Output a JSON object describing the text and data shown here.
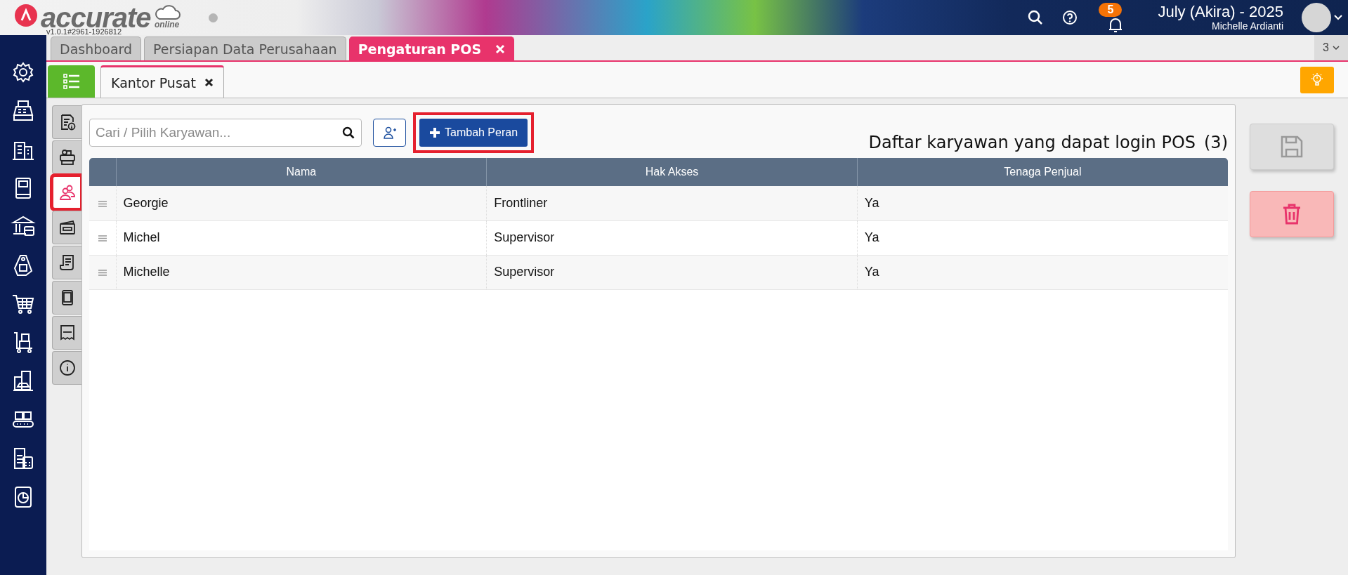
{
  "header": {
    "logo_text": "accurate",
    "logo_sub": "online",
    "version": "v1.0.1#2961-1926812",
    "notification_count": "5",
    "period": "July (Akira) - 2025",
    "user_name": "Michelle Ardianti"
  },
  "tabs": [
    {
      "label": "Dashboard",
      "selected": false,
      "closable": false
    },
    {
      "label": "Persiapan Data Perusahaan",
      "selected": false,
      "closable": false
    },
    {
      "label": "Pengaturan POS",
      "selected": true,
      "closable": true
    }
  ],
  "tab_count": "3",
  "sub_tabs": [
    {
      "label": "Kantor Pusat",
      "selected": true
    }
  ],
  "vertical_tabs": [
    {
      "kind": "doc-info",
      "selected": false,
      "highlighted": false
    },
    {
      "kind": "printer",
      "selected": false,
      "highlighted": false
    },
    {
      "kind": "people",
      "selected": true,
      "highlighted": true
    },
    {
      "kind": "card",
      "selected": false,
      "highlighted": false
    },
    {
      "kind": "receipt",
      "selected": false,
      "highlighted": false
    },
    {
      "kind": "tablet",
      "selected": false,
      "highlighted": false
    },
    {
      "kind": "numbered",
      "selected": false,
      "highlighted": false
    },
    {
      "kind": "info",
      "selected": false,
      "highlighted": false
    }
  ],
  "search": {
    "placeholder": "Cari / Pilih Karyawan..."
  },
  "add_role_button": {
    "label": "Tambah Peran",
    "highlighted": true
  },
  "list_title": "Daftar karyawan yang dapat login POS",
  "list_count": "(3)",
  "table": {
    "columns": [
      "Nama",
      "Hak Akses",
      "Tenaga Penjual"
    ],
    "rows": [
      [
        "Georgie",
        "Frontliner",
        "Ya"
      ],
      [
        "Michel",
        "Supervisor",
        "Ya"
      ],
      [
        "Michelle",
        "Supervisor",
        "Ya"
      ]
    ]
  },
  "save_button": {
    "disabled": true
  }
}
